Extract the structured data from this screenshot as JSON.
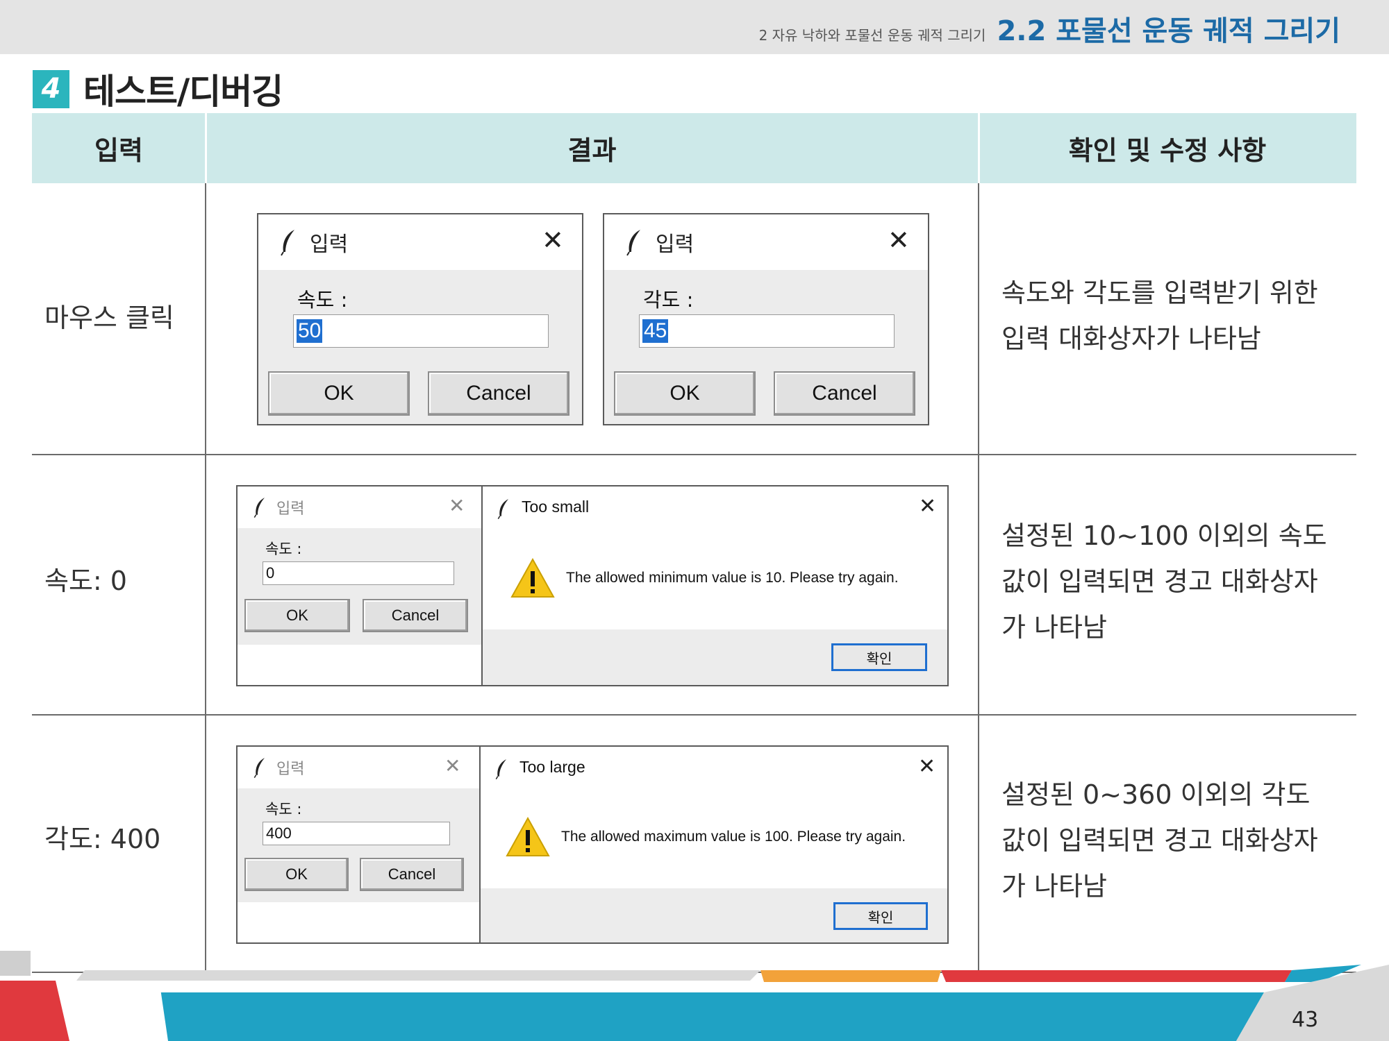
{
  "header": {
    "chapter": "2 자유 낙하와 포물선 운동 궤적 그리기",
    "section": "2.2 포물선 운동 궤적 그리기"
  },
  "heading": {
    "number": "4",
    "title": "테스트/디버깅"
  },
  "table": {
    "columns": [
      "입력",
      "결과",
      "확인 및 수정 사항"
    ],
    "rows": [
      {
        "input": "마우스 클릭",
        "notes": [
          "속도와 각도를 입력받기 위한",
          "입력 대화상자가 나타남"
        ],
        "dialogs": [
          {
            "title": "입력",
            "label": "속도 :",
            "value": "50",
            "ok": "OK",
            "cancel": "Cancel"
          },
          {
            "title": "입력",
            "label": "각도 :",
            "value": "45",
            "ok": "OK",
            "cancel": "Cancel"
          }
        ]
      },
      {
        "input": "속도: 0",
        "notes": [
          "설정된 10~100 이외의 속도",
          "값이 입력되면 경고 대화상자",
          "가 나타남"
        ],
        "dialog": {
          "title": "입력",
          "label": "속도 :",
          "value": "0",
          "ok": "OK",
          "cancel": "Cancel"
        },
        "message": {
          "title": "Too small",
          "text": "The allowed minimum value is 10. Please try again.",
          "button": "확인"
        }
      },
      {
        "input": "각도: 400",
        "notes": [
          "설정된 0~360 이외의 각도",
          "값이 입력되면 경고 대화상자",
          "가 나타남"
        ],
        "dialog": {
          "title": "입력",
          "label": "속도 :",
          "value": "400",
          "ok": "OK",
          "cancel": "Cancel"
        },
        "message": {
          "title": "Too large",
          "text": "The allowed maximum value is 100. Please try again.",
          "button": "확인"
        }
      }
    ]
  },
  "page_number": "43",
  "colors": {
    "accent": "#1c6aa6",
    "teal": "#2bb5bd",
    "header_fill": "#cde9e9",
    "footer_blue": "#1fa2c4",
    "footer_red": "#e0393e",
    "footer_orange": "#f2a23a"
  },
  "icons": [
    "feather-icon",
    "close-icon",
    "warning-icon"
  ]
}
